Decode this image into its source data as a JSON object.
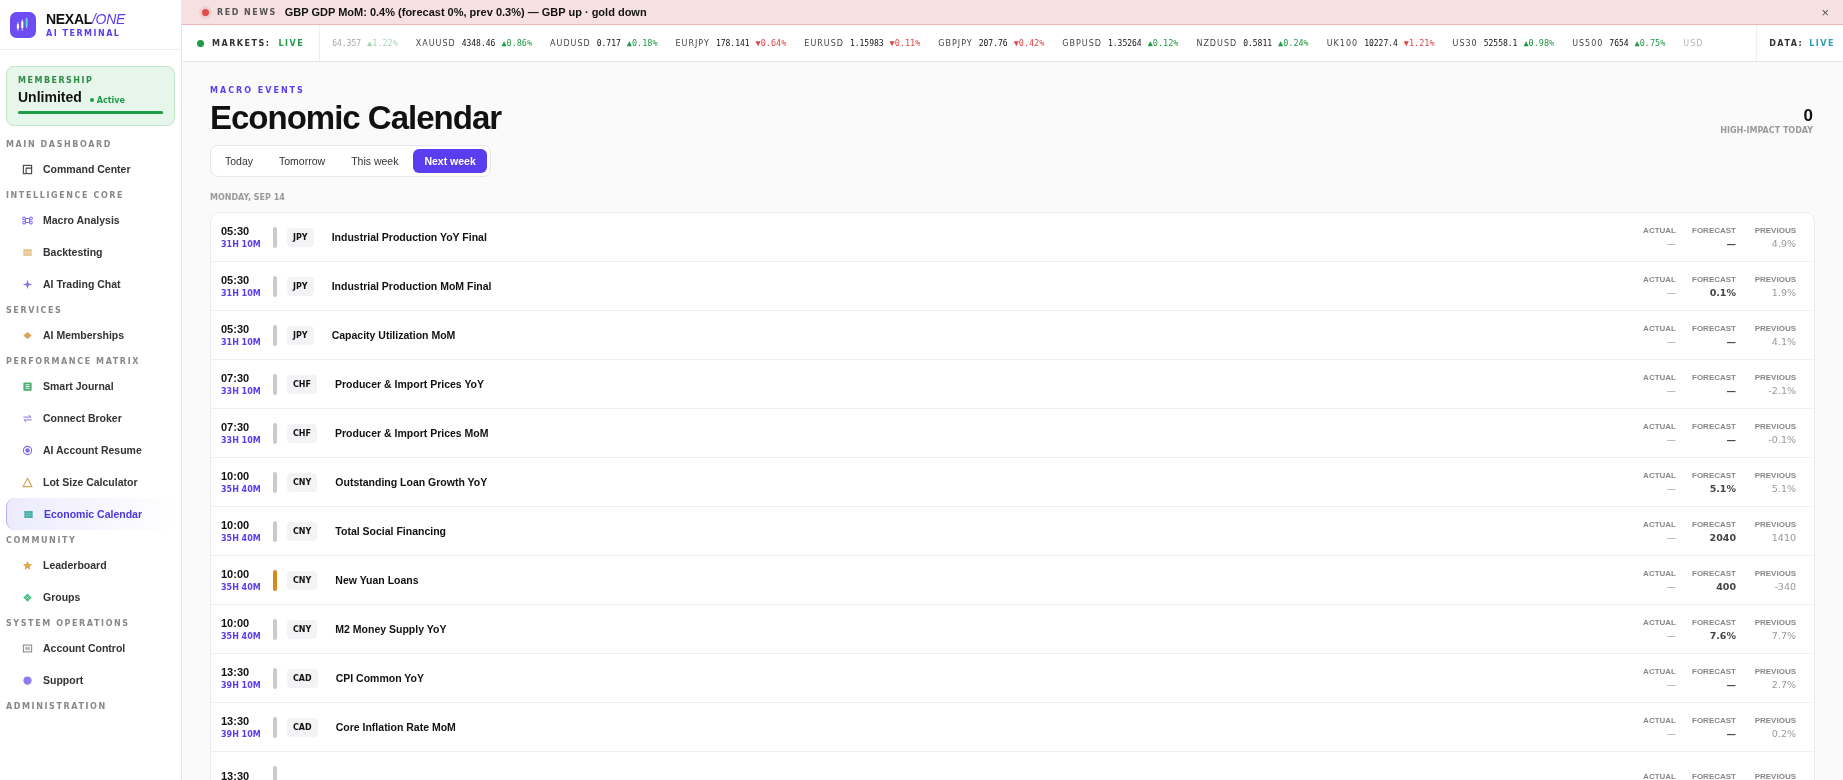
{
  "brand": {
    "name": "NEXAL",
    "name_accent": "/ONE",
    "subtitle": "AI TERMINAL"
  },
  "membership": {
    "label": "MEMBERSHIP",
    "plan": "Unlimited",
    "status": "Active",
    "level": 1
  },
  "sidebar": {
    "sections": [
      {
        "title": "MAIN DASHBOARD",
        "items": [
          {
            "label": "Command Center",
            "selected": false
          }
        ]
      },
      {
        "title": "INTELLIGENCE CORE",
        "items": [
          {
            "label": "Macro Analysis",
            "selected": false
          },
          {
            "label": "Backtesting",
            "selected": false
          },
          {
            "label": "AI Trading Chat",
            "selected": false
          }
        ]
      },
      {
        "title": "SERVICES",
        "items": [
          {
            "label": "AI Memberships",
            "selected": false
          }
        ]
      },
      {
        "title": "PERFORMANCE MATRIX",
        "items": [
          {
            "label": "Smart Journal",
            "selected": false
          },
          {
            "label": "Connect Broker",
            "selected": false
          },
          {
            "label": "AI Account Resume",
            "selected": false
          },
          {
            "label": "Lot Size Calculator",
            "selected": false
          },
          {
            "label": "Economic Calendar",
            "selected": true
          }
        ]
      },
      {
        "title": "COMMUNITY",
        "items": [
          {
            "label": "Leaderboard",
            "selected": false
          },
          {
            "label": "Groups",
            "selected": false
          }
        ]
      },
      {
        "title": "SYSTEM OPERATIONS",
        "items": [
          {
            "label": "Account Control",
            "selected": false
          },
          {
            "label": "Support",
            "selected": false
          }
        ]
      },
      {
        "title": "ADMINISTRATION"
      }
    ]
  },
  "news": {
    "label": "RED NEWS",
    "text": "GBP GDP MoM: 0.4% (forecast 0%, prev 0.3%) — GBP up · gold down",
    "close": "×"
  },
  "ticker": {
    "label": "MARKETS:",
    "status": "LIVE",
    "data_label": "DATA:",
    "data_status": "LIVE",
    "items": [
      {
        "price": "64.357",
        "change": "▲1.22%",
        "kind": "up",
        "faded": true
      },
      {
        "symbol": "XAUUSD",
        "price": "4348.46",
        "change": "▲0.86%",
        "kind": "up",
        "faded": false
      },
      {
        "symbol": "AUDUSD",
        "price": "0.717",
        "change": "▲0.18%",
        "kind": "up",
        "faded": false
      },
      {
        "symbol": "EURJPY",
        "price": "178.141",
        "change": "▼0.64%",
        "kind": "down",
        "faded": false
      },
      {
        "symbol": "EURUSD",
        "price": "1.15983",
        "change": "▼0.11%",
        "kind": "down",
        "faded": false
      },
      {
        "symbol": "GBPJPY",
        "price": "207.76",
        "change": "▼0.42%",
        "kind": "down",
        "faded": false
      },
      {
        "symbol": "GBPUSD",
        "price": "1.35264",
        "change": "▲0.12%",
        "kind": "up",
        "faded": false
      },
      {
        "symbol": "NZDUSD",
        "price": "0.5811",
        "change": "▲0.24%",
        "kind": "up",
        "faded": false
      },
      {
        "symbol": "UK100",
        "price": "10227.4",
        "change": "▼1.21%",
        "kind": "down",
        "faded": false
      },
      {
        "symbol": "US30",
        "price": "52558.1",
        "change": "▲0.98%",
        "kind": "up",
        "faded": false
      },
      {
        "symbol": "US500",
        "price": "7654",
        "change": "▲0.75%",
        "kind": "up",
        "faded": false
      },
      {
        "symbol": "USD",
        "faded": true
      }
    ]
  },
  "header": {
    "eyebrow": "MACRO EVENTS",
    "title": "Economic Calendar",
    "stat_value": "0",
    "stat_label": "HIGH-IMPACT TODAY"
  },
  "tabs": [
    {
      "label": "Today",
      "selected": false
    },
    {
      "label": "Tomorrow",
      "selected": false
    },
    {
      "label": "This week",
      "selected": false
    },
    {
      "label": "Next week",
      "selected": true
    }
  ],
  "day_label": "MONDAY, SEP 14",
  "events": [
    {
      "time": "05:30",
      "countdown": "31H 10M",
      "color": "#c9c9d0",
      "currency": "JPY",
      "title": "Industrial Production YoY Final",
      "values": [
        {
          "label": "ACTUAL",
          "value": "—"
        },
        {
          "label": "FORECAST",
          "value": "—"
        },
        {
          "label": "PREVIOUS",
          "value": "4.9%"
        }
      ]
    },
    {
      "time": "05:30",
      "countdown": "31H 10M",
      "color": "#c9c9d0",
      "currency": "JPY",
      "title": "Industrial Production MoM Final",
      "values": [
        {
          "label": "ACTUAL",
          "value": "—"
        },
        {
          "label": "FORECAST",
          "value": "0.1%"
        },
        {
          "label": "PREVIOUS",
          "value": "1.9%"
        }
      ]
    },
    {
      "time": "05:30",
      "countdown": "31H 10M",
      "color": "#c9c9d0",
      "currency": "JPY",
      "title": "Capacity Utilization MoM",
      "values": [
        {
          "label": "ACTUAL",
          "value": "—"
        },
        {
          "label": "FORECAST",
          "value": "—"
        },
        {
          "label": "PREVIOUS",
          "value": "4.1%"
        }
      ]
    },
    {
      "time": "07:30",
      "countdown": "33H 10M",
      "color": "#c9c9d0",
      "currency": "CHF",
      "title": "Producer & Import Prices YoY",
      "values": [
        {
          "label": "ACTUAL",
          "value": "—"
        },
        {
          "label": "FORECAST",
          "value": "—"
        },
        {
          "label": "PREVIOUS",
          "value": "-2.1%"
        }
      ]
    },
    {
      "time": "07:30",
      "countdown": "33H 10M",
      "color": "#c9c9d0",
      "currency": "CHF",
      "title": "Producer & Import Prices MoM",
      "values": [
        {
          "label": "ACTUAL",
          "value": "—"
        },
        {
          "label": "FORECAST",
          "value": "—"
        },
        {
          "label": "PREVIOUS",
          "value": "-0.1%"
        }
      ]
    },
    {
      "time": "10:00",
      "countdown": "35H 40M",
      "color": "#c9c9d0",
      "currency": "CNY",
      "title": "Outstanding Loan Growth YoY",
      "values": [
        {
          "label": "ACTUAL",
          "value": "—"
        },
        {
          "label": "FORECAST",
          "value": "5.1%"
        },
        {
          "label": "PREVIOUS",
          "value": "5.1%"
        }
      ]
    },
    {
      "time": "10:00",
      "countdown": "35H 40M",
      "color": "#c9c9d0",
      "currency": "CNY",
      "title": "Total Social Financing",
      "values": [
        {
          "label": "ACTUAL",
          "value": "—"
        },
        {
          "label": "FORECAST",
          "value": "2040"
        },
        {
          "label": "PREVIOUS",
          "value": "1410"
        }
      ]
    },
    {
      "time": "10:00",
      "countdown": "35H 40M",
      "color": "#d98a1c",
      "currency": "CNY",
      "title": "New Yuan Loans",
      "values": [
        {
          "label": "ACTUAL",
          "value": "—"
        },
        {
          "label": "FORECAST",
          "value": "400"
        },
        {
          "label": "PREVIOUS",
          "value": "-340"
        }
      ]
    },
    {
      "time": "10:00",
      "countdown": "35H 40M",
      "color": "#c9c9d0",
      "currency": "CNY",
      "title": "M2 Money Supply YoY",
      "values": [
        {
          "label": "ACTUAL",
          "value": "—"
        },
        {
          "label": "FORECAST",
          "value": "7.6%"
        },
        {
          "label": "PREVIOUS",
          "value": "7.7%"
        }
      ]
    },
    {
      "time": "13:30",
      "countdown": "39H 10M",
      "color": "#c9c9d0",
      "currency": "CAD",
      "title": "CPI Common YoY",
      "values": [
        {
          "label": "ACTUAL",
          "value": "—"
        },
        {
          "label": "FORECAST",
          "value": "—"
        },
        {
          "label": "PREVIOUS",
          "value": "2.7%"
        }
      ]
    },
    {
      "time": "13:30",
      "countdown": "39H 10M",
      "color": "#c9c9d0",
      "currency": "CAD",
      "title": "Core Inflation Rate MoM",
      "values": [
        {
          "label": "ACTUAL",
          "value": "—"
        },
        {
          "label": "FORECAST",
          "value": "—"
        },
        {
          "label": "PREVIOUS",
          "value": "0.2%"
        }
      ]
    },
    {
      "time": "13:30",
      "color": "#c9c9d0",
      "values": [
        {
          "label": "ACTUAL"
        },
        {
          "label": "FORECAST"
        },
        {
          "label": "PREVIOUS"
        }
      ]
    }
  ]
}
